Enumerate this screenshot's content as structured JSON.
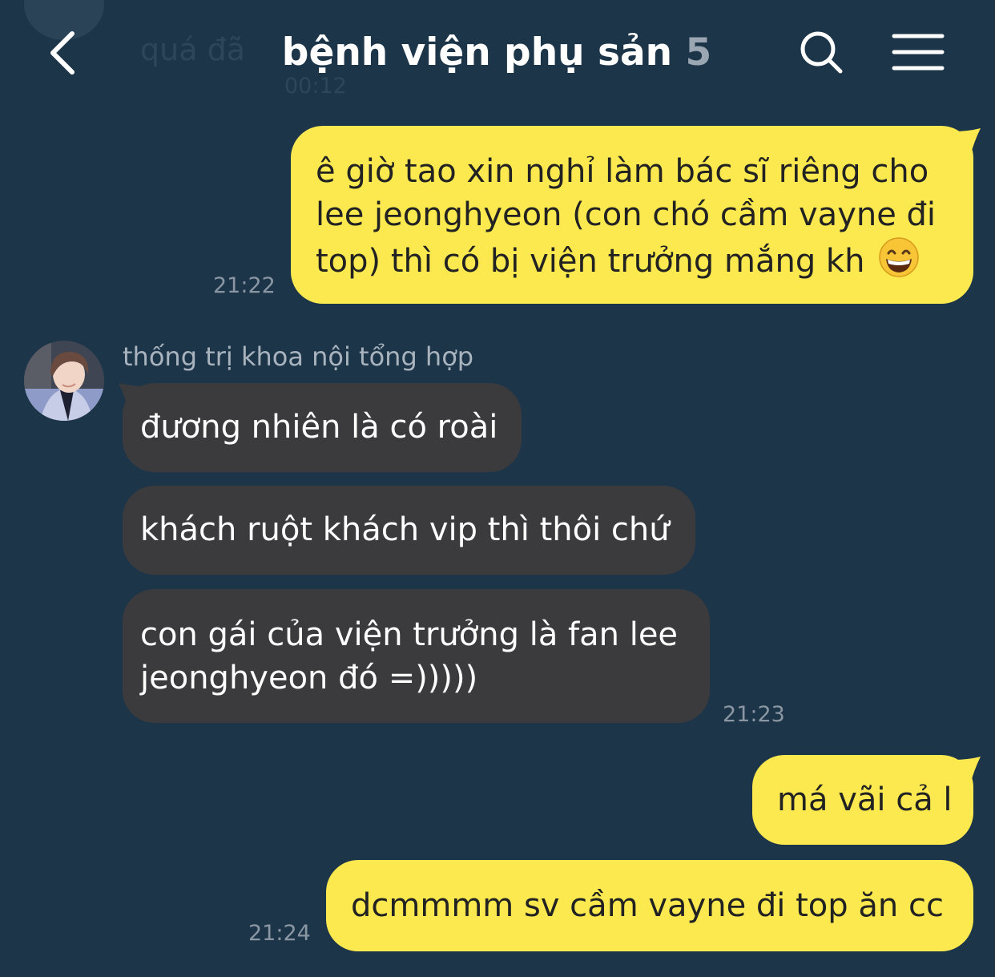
{
  "header": {
    "title": "bệnh viện phụ sản",
    "member_count": "5",
    "back_icon": "chevron-left-icon",
    "search_icon": "search-icon",
    "menu_icon": "hamburger-menu-icon"
  },
  "faded_previous": {
    "text": "quá đã",
    "time": "00:12"
  },
  "colors": {
    "background": "#1d3549",
    "my_bubble": "#fbe94f",
    "their_bubble": "#3b3b3d",
    "timestamp": "#8a97a3"
  },
  "messages": {
    "m1": {
      "lines": [
        "ê giờ tao xin nghỉ làm bác sĩ riêng cho",
        "lee jeonghyeon (con chó cầm vayne đi",
        "top) thì có bị viện trưởng mắng kh"
      ],
      "emoji": "grinning-face-with-smiling-eyes",
      "time": "21:22"
    },
    "sender": {
      "name": "thống trị khoa nội tổng hợp"
    },
    "m2": {
      "text": "đương nhiên là có roài"
    },
    "m3": {
      "text": "khách ruột khách vip thì thôi chứ"
    },
    "m4": {
      "lines": [
        "con gái của viện trưởng là fan lee",
        "jeonghyeon đó =)))))"
      ],
      "time": "21:23"
    },
    "m5": {
      "text": "má vãi cả l"
    },
    "m6": {
      "text": "dcmmmm sv cầm vayne đi top ăn cc",
      "time": "21:24"
    }
  }
}
